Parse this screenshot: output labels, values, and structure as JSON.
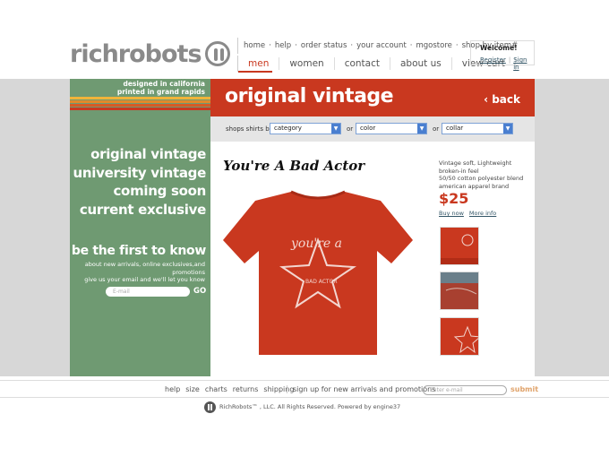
{
  "logo": {
    "text": "richrobots"
  },
  "top_links": [
    "home",
    "help",
    "order status",
    "your account",
    "mgostore",
    "shop by item#"
  ],
  "top_links_separators": [
    "·",
    "·",
    "·",
    "·",
    "·"
  ],
  "main_nav": [
    {
      "label": "men",
      "active": true
    },
    {
      "label": "women",
      "active": false
    },
    {
      "label": "contact",
      "active": false
    },
    {
      "label": "about us",
      "active": false
    },
    {
      "label": "view cart",
      "active": false
    }
  ],
  "welcome": {
    "title": "Welcome!",
    "register": "Register",
    "sep": "|",
    "signin": "Sign in"
  },
  "left": {
    "designed_line1": "designed in california",
    "designed_line2": "printed in grand rapids",
    "stripe_colors": [
      "#f0b43a",
      "#e08a2c",
      "#d65a26",
      "#c9381f"
    ],
    "links": [
      "original vintage",
      "university vintage",
      "coming soon",
      "current exclusive"
    ],
    "first_title": "be the first to know",
    "first_sub1": "about new arrivals, online exclusives,and",
    "first_sub2": "promotions",
    "first_sub3": "give us your email and we'll let you know",
    "email_placeholder": "E-mail",
    "go": "GO"
  },
  "header": {
    "title": "original vintage",
    "back": "back",
    "back_arrow": "‹"
  },
  "filters": {
    "label": "shops shirts by",
    "category": "category",
    "or1": "or",
    "color": "color",
    "or2": "or",
    "collar": "collar",
    "arrow": "▼"
  },
  "product": {
    "title": "You're A Bad Actor",
    "desc1": "Vintage soft, Lightweight",
    "desc2": "broken-in feel",
    "desc3": "50/50 cotton polyester blend",
    "desc4": "american apparel brand",
    "price": "$25",
    "buy_now": "Buy now",
    "more_info": "More info",
    "shirt_print": "you're a",
    "shirt_star_text": "BAD ACTOR"
  },
  "footer": {
    "links": [
      "help",
      "size",
      "charts",
      "returns",
      "shipping"
    ],
    "signup": "sign up for new arrivals and promotions",
    "email_placeholder": "Enter e-mail",
    "submit": "submit",
    "copyright": "RichRobots™ , LLC. All Rights Reserved. Powered by engine37"
  },
  "colors": {
    "brand_red": "#c9381f",
    "green": "#6f9a72",
    "link": "#335566"
  }
}
